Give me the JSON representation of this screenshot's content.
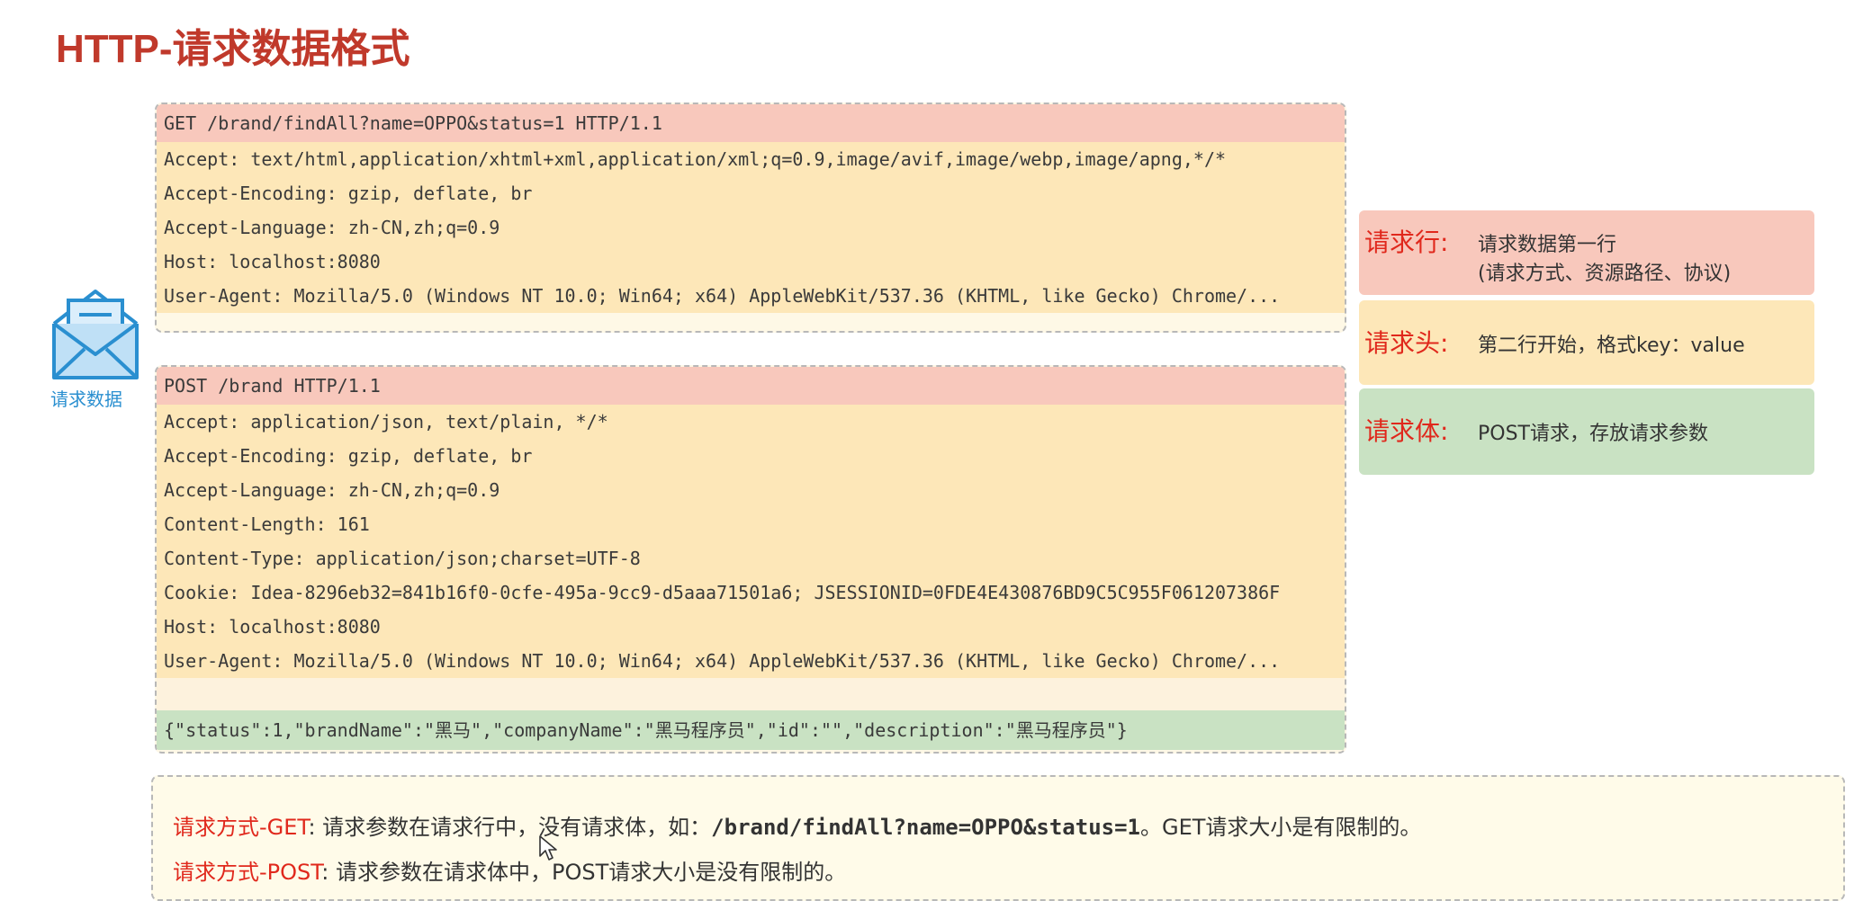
{
  "page": {
    "title": "HTTP-请求数据格式"
  },
  "get_request": {
    "request_line": "GET /brand/findAll?name=OPPO&status=1 HTTP/1.1",
    "headers": [
      "Accept: text/html,application/xhtml+xml,application/xml;q=0.9,image/avif,image/webp,image/apng,*/*",
      "Accept-Encoding: gzip, deflate, br",
      "Accept-Language: zh-CN,zh;q=0.9",
      "Host: localhost:8080",
      "User-Agent: Mozilla/5.0 (Windows NT 10.0; Win64; x64) AppleWebKit/537.36 (KHTML, like Gecko) Chrome/..."
    ]
  },
  "post_request": {
    "request_line": "POST /brand HTTP/1.1",
    "headers": [
      "Accept: application/json, text/plain, */*",
      "Accept-Encoding: gzip, deflate, br",
      "Accept-Language: zh-CN,zh;q=0.9",
      "Content-Length: 161",
      "Content-Type: application/json;charset=UTF-8",
      "Cookie: Idea-8296eb32=841b16f0-0cfe-495a-9cc9-d5aaa71501a6; JSESSIONID=0FDE4E430876BD9C5C955F061207386F",
      "Host: localhost:8080",
      "User-Agent: Mozilla/5.0 (Windows NT 10.0; Win64; x64) AppleWebKit/537.36 (KHTML, like Gecko) Chrome/..."
    ],
    "body": "{\"status\":1,\"brandName\":\"黑马\",\"companyName\":\"黑马程序员\",\"id\":\"\",\"description\":\"黑马程序员\"}"
  },
  "envelope": {
    "icon": "envelope-icon",
    "label": "请求数据"
  },
  "legend": {
    "request_line": {
      "key": "请求行:",
      "desc": "请求数据第一行",
      "desc2": "(请求方式、资源路径、协议)"
    },
    "request_header": {
      "key": "请求头:",
      "desc": "第二行开始，格式key：value"
    },
    "request_body": {
      "key": "请求体:",
      "desc": "POST请求，存放请求参数"
    }
  },
  "notes": {
    "get": {
      "key": "请求方式-GET",
      "text1": ": 请求参数在请求行中，没有请求体，如：",
      "code": "/brand/findAll?name=OPPO&status=1",
      "text2": "。GET请求大小是有限制的。"
    },
    "post": {
      "key": "请求方式-POST",
      "text1": ": 请求参数在请求体中，POST请求大小是没有限制的。"
    }
  },
  "colors": {
    "title": "#c0392b",
    "request_line_bg": "#f8c8bc",
    "header_bg": "#fde7b8",
    "body_bg": "#c9e2c3",
    "accent_red": "#e0281c",
    "icon_blue": "#2a8fd0"
  }
}
